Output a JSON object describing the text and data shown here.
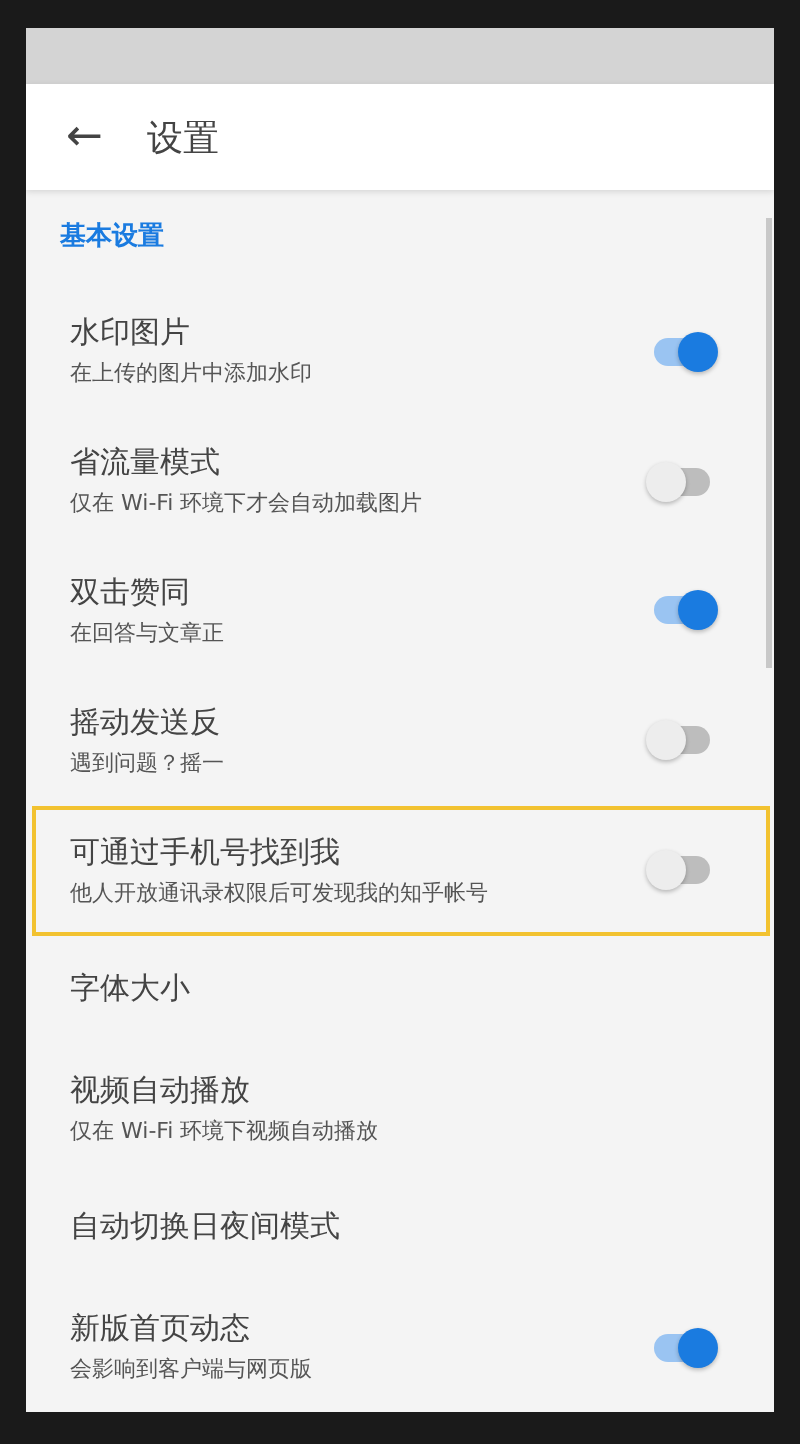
{
  "toolbar": {
    "back": "←",
    "title": "设置"
  },
  "section": {
    "title": "基本设置"
  },
  "items": [
    {
      "kind": "toggle",
      "title": "水印图片",
      "subtitle": "在上传的图片中添加水印",
      "on": true,
      "highlighted": false
    },
    {
      "kind": "toggle",
      "title": "省流量模式",
      "subtitle": "仅在 Wi-Fi 环境下才会自动加载图片",
      "on": false,
      "highlighted": false
    },
    {
      "kind": "toggle",
      "title": "双击赞同",
      "subtitle": "在回答与文章正",
      "on": true,
      "highlighted": false
    },
    {
      "kind": "toggle",
      "title": "摇动发送反",
      "subtitle": "遇到问题？摇一",
      "on": false,
      "highlighted": false
    },
    {
      "kind": "toggle",
      "title": "可通过手机号找到我",
      "subtitle": "他人开放通讯录权限后可发现我的知乎帐号",
      "on": false,
      "highlighted": true
    },
    {
      "kind": "plain",
      "title": "字体大小",
      "highlighted": false
    },
    {
      "kind": "plain",
      "title": "视频自动播放",
      "subtitle": "仅在 Wi-Fi 环境下视频自动播放",
      "highlighted": false
    },
    {
      "kind": "plain",
      "title": "自动切换日夜间模式",
      "highlighted": false
    },
    {
      "kind": "toggle",
      "title": "新版首页动态",
      "subtitle": "会影响到客户端与网页版",
      "on": true,
      "highlighted": false
    }
  ]
}
